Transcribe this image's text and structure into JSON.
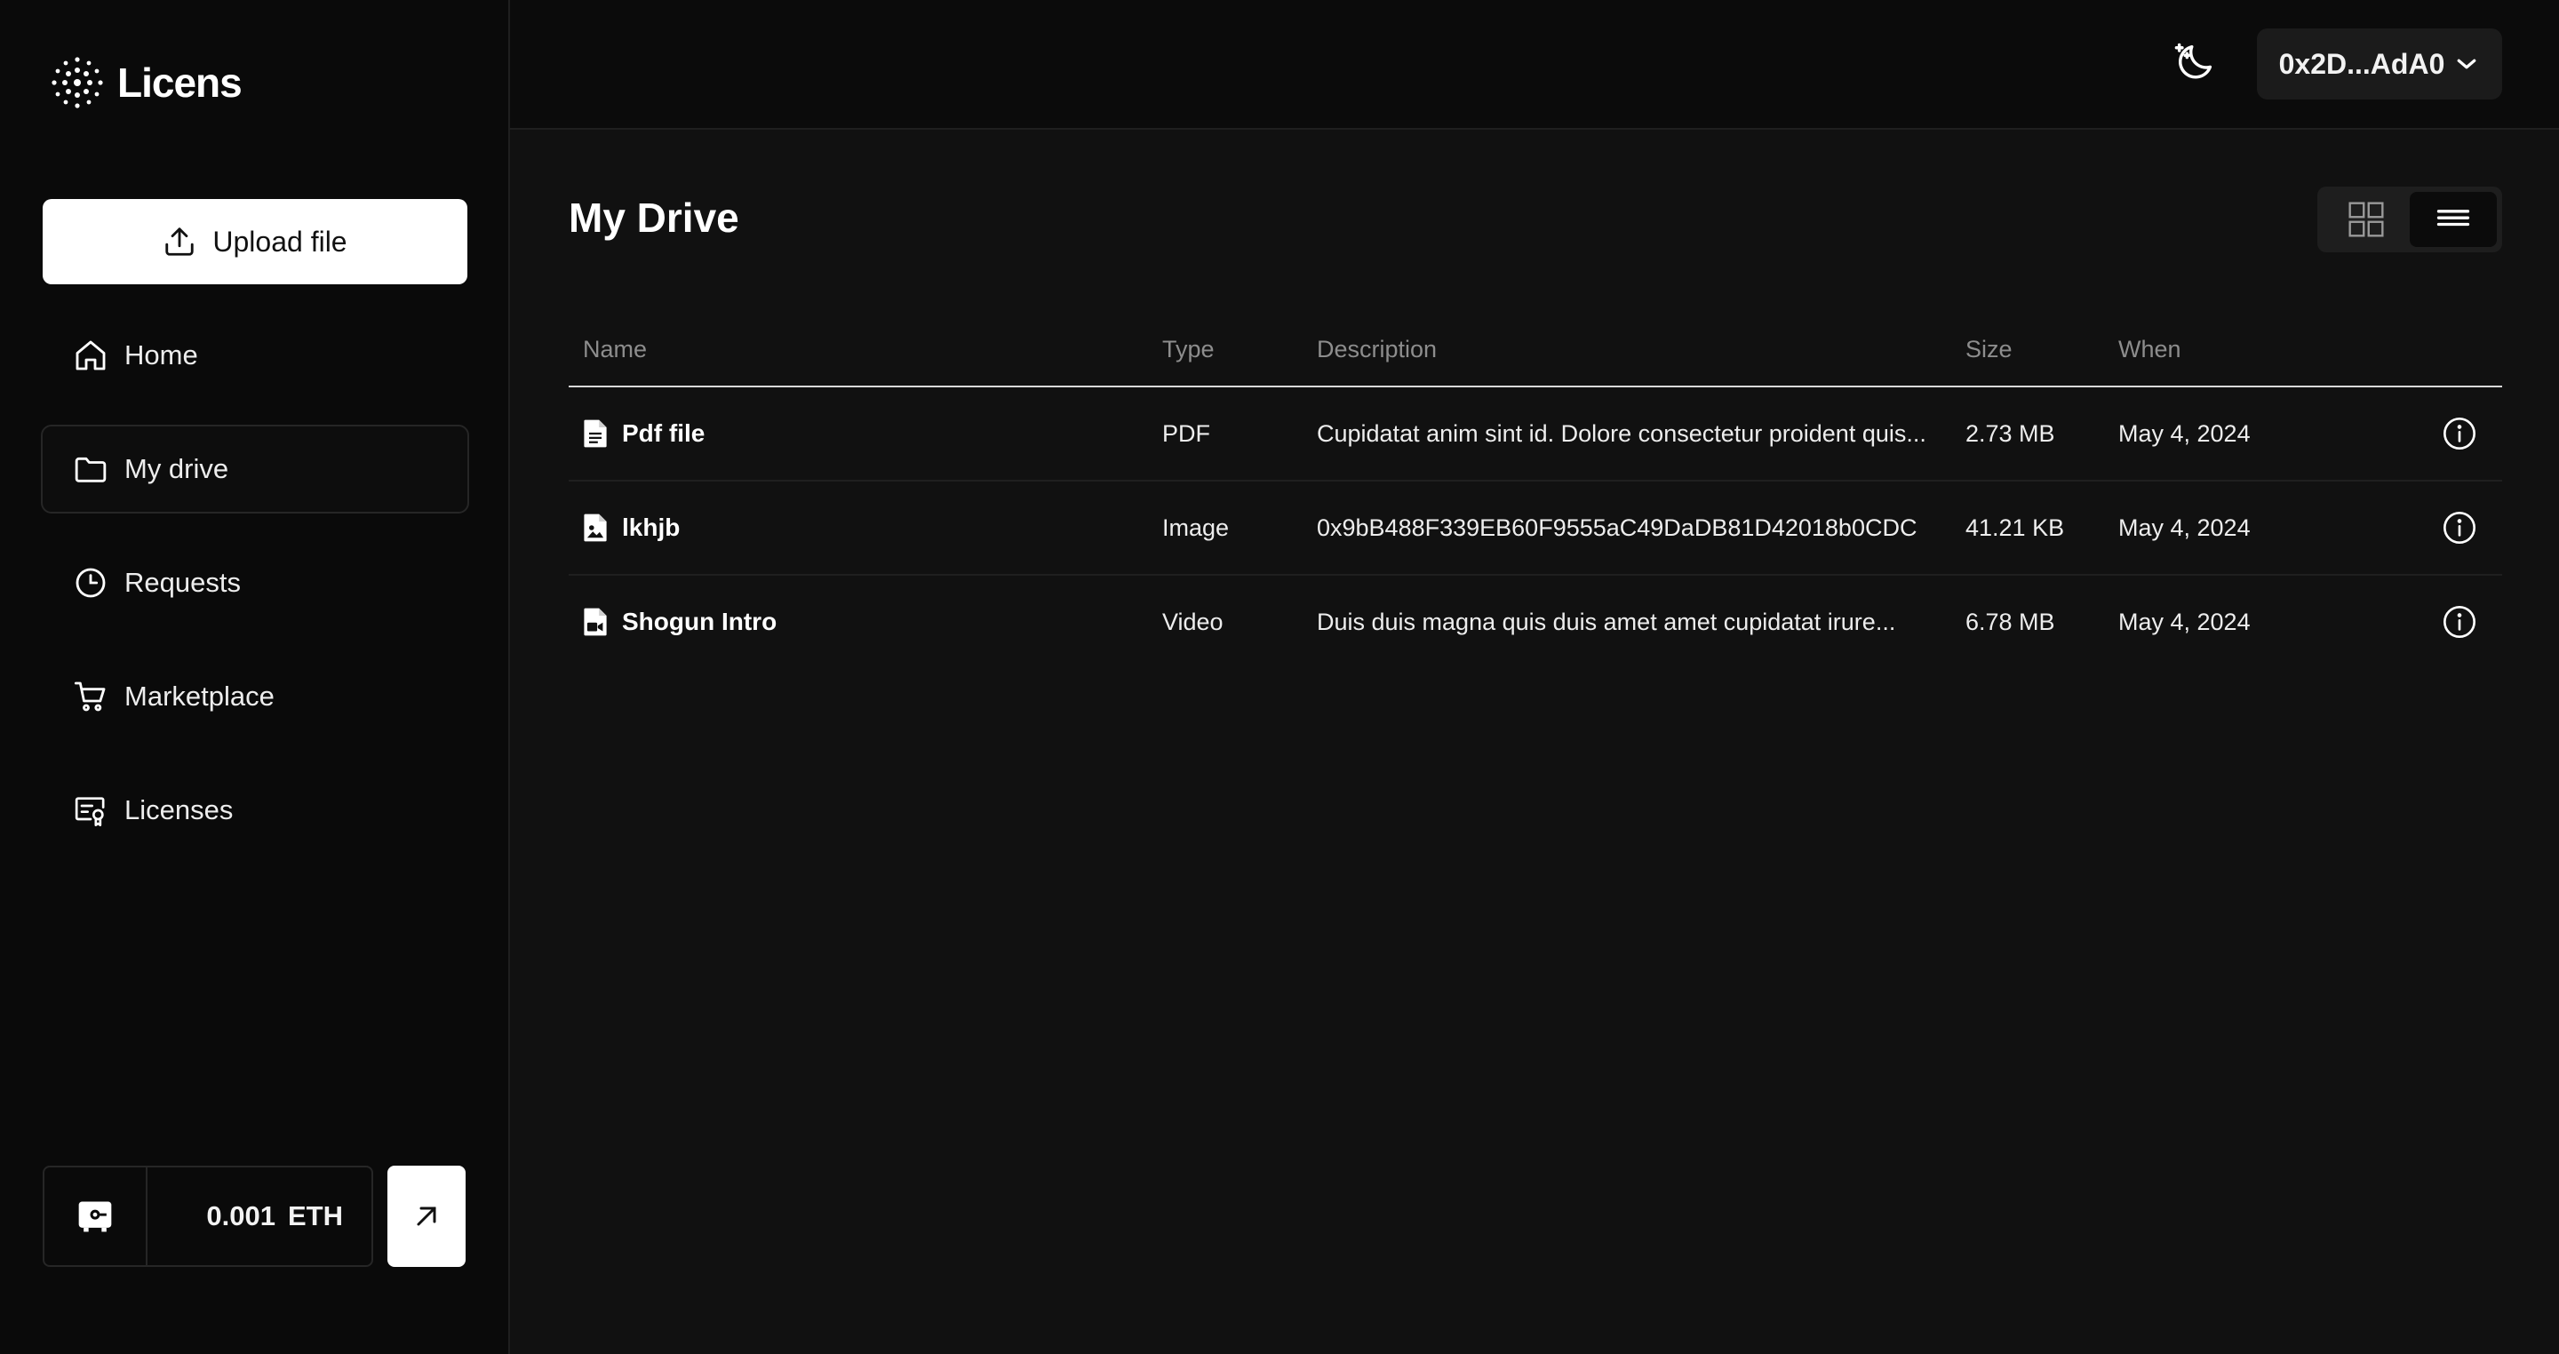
{
  "app": {
    "name": "Licens"
  },
  "sidebar": {
    "upload_label": "Upload file",
    "items": [
      {
        "label": "Home",
        "icon": "home-icon"
      },
      {
        "label": "My drive",
        "icon": "folder-icon",
        "active": true
      },
      {
        "label": "Requests",
        "icon": "clock-icon"
      },
      {
        "label": "Marketplace",
        "icon": "cart-icon"
      },
      {
        "label": "Licenses",
        "icon": "license-icon"
      }
    ],
    "wallet": {
      "amount": "0.001",
      "unit": "ETH"
    }
  },
  "header": {
    "account_label": "0x2D...AdA0"
  },
  "main": {
    "title": "My Drive",
    "columns": {
      "name": "Name",
      "type": "Type",
      "description": "Description",
      "size": "Size",
      "when": "When"
    },
    "files": [
      {
        "name": "Pdf file",
        "type": "PDF",
        "description": "Cupidatat anim sint id. Dolore consectetur proident quis...",
        "size": "2.73 MB",
        "when": "May 4, 2024",
        "icon": "pdf-file-icon"
      },
      {
        "name": "lkhjb",
        "type": "Image",
        "description": "0x9bB488F339EB60F9555aC49DaDB81D42018b0CDC",
        "size": "41.21 KB",
        "when": "May 4, 2024",
        "icon": "image-file-icon"
      },
      {
        "name": "Shogun Intro",
        "type": "Video",
        "description": "Duis duis magna quis duis amet amet cupidatat irure...",
        "size": "6.78 MB",
        "when": "May 4, 2024",
        "icon": "video-file-icon"
      }
    ]
  },
  "colors": {
    "background": "#111111",
    "sidebar": "#0a0a0a",
    "accent": "#ffffff",
    "muted": "#8d8d8d"
  }
}
